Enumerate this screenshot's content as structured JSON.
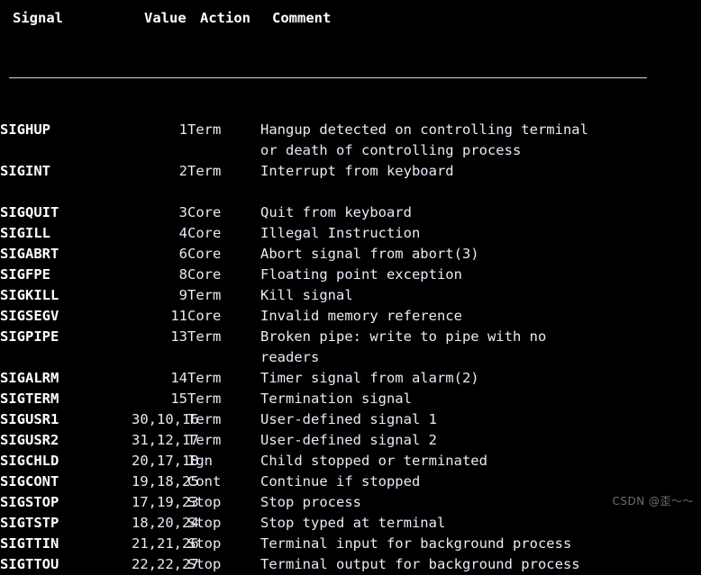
{
  "page": {
    "background_color": "#000000",
    "text_color": "#e8eaf6",
    "signal_color": "#ffffff",
    "rule_color": "#d8d8d8"
  },
  "table": {
    "headers": {
      "signal": "Signal",
      "value": "Value",
      "action": "Action",
      "comment": "Comment"
    },
    "rows": [
      {
        "signal": "SIGHUP",
        "value": "1",
        "action": "Term",
        "comment_lines": [
          "Hangup detected on controlling terminal",
          "or death of controlling process"
        ],
        "gap_after": false
      },
      {
        "signal": "SIGINT",
        "value": "2",
        "action": "Term",
        "comment_lines": [
          "Interrupt from keyboard"
        ],
        "gap_after": true
      },
      {
        "signal": "SIGQUIT",
        "value": "3",
        "action": "Core",
        "comment_lines": [
          "Quit from keyboard"
        ],
        "gap_after": false
      },
      {
        "signal": "SIGILL",
        "value": "4",
        "action": "Core",
        "comment_lines": [
          "Illegal Instruction"
        ],
        "gap_after": false
      },
      {
        "signal": "SIGABRT",
        "value": "6",
        "action": "Core",
        "comment_lines": [
          "Abort signal from abort(3)"
        ],
        "gap_after": false
      },
      {
        "signal": "SIGFPE",
        "value": "8",
        "action": "Core",
        "comment_lines": [
          "Floating point exception"
        ],
        "gap_after": false
      },
      {
        "signal": "SIGKILL",
        "value": "9",
        "action": "Term",
        "comment_lines": [
          "Kill signal"
        ],
        "gap_after": false
      },
      {
        "signal": "SIGSEGV",
        "value": "11",
        "action": "Core",
        "comment_lines": [
          "Invalid memory reference"
        ],
        "gap_after": false
      },
      {
        "signal": "SIGPIPE",
        "value": "13",
        "action": "Term",
        "comment_lines": [
          "Broken pipe: write to pipe with no",
          "readers"
        ],
        "gap_after": false
      },
      {
        "signal": "SIGALRM",
        "value": "14",
        "action": "Term",
        "comment_lines": [
          "Timer signal from alarm(2)"
        ],
        "gap_after": false
      },
      {
        "signal": "SIGTERM",
        "value": "15",
        "action": "Term",
        "comment_lines": [
          "Termination signal"
        ],
        "gap_after": false
      },
      {
        "signal": "SIGUSR1",
        "value": "30,10,16",
        "action": "Term",
        "comment_lines": [
          "User-defined signal 1"
        ],
        "gap_after": false
      },
      {
        "signal": "SIGUSR2",
        "value": "31,12,17",
        "action": "Term",
        "comment_lines": [
          "User-defined signal 2"
        ],
        "gap_after": false
      },
      {
        "signal": "SIGCHLD",
        "value": "20,17,18",
        "action": "Ign",
        "comment_lines": [
          "Child stopped or terminated"
        ],
        "gap_after": false
      },
      {
        "signal": "SIGCONT",
        "value": "19,18,25",
        "action": "Cont",
        "comment_lines": [
          "Continue if stopped"
        ],
        "gap_after": false
      },
      {
        "signal": "SIGSTOP",
        "value": "17,19,23",
        "action": "Stop",
        "comment_lines": [
          "Stop process"
        ],
        "gap_after": false
      },
      {
        "signal": "SIGTSTP",
        "value": "18,20,24",
        "action": "Stop",
        "comment_lines": [
          "Stop typed at terminal"
        ],
        "gap_after": false
      },
      {
        "signal": "SIGTTIN",
        "value": "21,21,26",
        "action": "Stop",
        "comment_lines": [
          "Terminal input for background process"
        ],
        "gap_after": false
      },
      {
        "signal": "SIGTTOU",
        "value": "22,22,27",
        "action": "Stop",
        "comment_lines": [
          "Terminal output for background process"
        ],
        "gap_after": false
      }
    ]
  },
  "watermark": {
    "text": "CSDN @歪～～"
  }
}
